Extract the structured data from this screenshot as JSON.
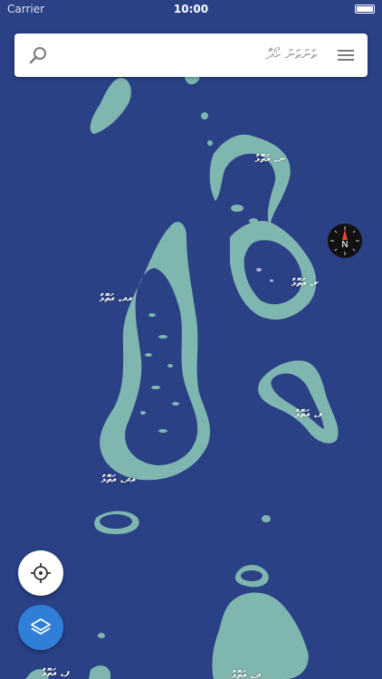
{
  "status_bar": {
    "carrier": "Carrier",
    "time": "10:00",
    "battery_icon": "battery-icon"
  },
  "search": {
    "placeholder": "ތަންތަން ހޯދާ",
    "search_icon": "search-icon",
    "menu_icon": "menu-icon"
  },
  "compass": {
    "letter": "N",
    "icon": "compass-icon"
  },
  "atoll_labels": [
    {
      "id": "n",
      "text": "ނ. އަތޮޅު"
    },
    {
      "id": "k",
      "text": "ކ. އަތޮޅު"
    },
    {
      "id": "aa",
      "text": "އއ. އަތޮޅު"
    },
    {
      "id": "v",
      "text": "ވ. އަތޮޅު"
    },
    {
      "id": "adh",
      "text": "އދ. އަތޮޅު"
    },
    {
      "id": "f",
      "text": "ފ. އަތޮޅު"
    },
    {
      "id": "dh",
      "text": "ދ. އަތޮޅު"
    }
  ],
  "controls": {
    "location_icon": "my-location-icon",
    "layers_icon": "layers-icon"
  },
  "colors": {
    "sea": "#2a4186",
    "reef": "#7fb7b0",
    "accent": "#2f7fd8",
    "compass_needle": "#e2452e"
  }
}
